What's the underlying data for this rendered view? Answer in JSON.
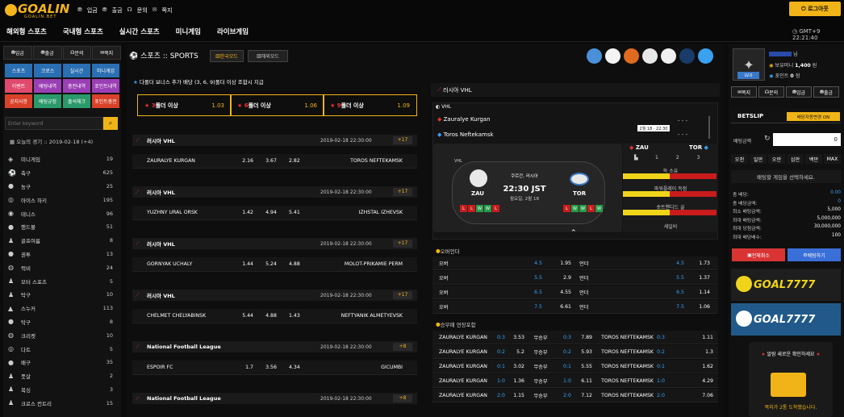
{
  "header": {
    "brand": "GOALIN",
    "brand_sub": "GOALIN.BET",
    "links": [
      "입금",
      "출금",
      "문의",
      "쪽지"
    ],
    "logout": "로그아웃",
    "nav": [
      "해외형 스포츠",
      "국내형 스포츠",
      "실시간 스포츠",
      "미니게임",
      "라이브게임"
    ],
    "clock": "GMT+9 22:21:40"
  },
  "sidebar": {
    "quick": [
      "입금",
      "출금",
      "문의",
      "쪽지"
    ],
    "categories": [
      {
        "label": "스포츠",
        "color": "#2b6fb3"
      },
      {
        "label": "크로스",
        "color": "#2b6fb3"
      },
      {
        "label": "실시간",
        "color": "#2b6fb3"
      },
      {
        "label": "미니게임",
        "color": "#2b6fb3"
      },
      {
        "label": "이벤트",
        "color": "#e04a6d"
      },
      {
        "label": "배팅내역",
        "color": "#9b3fb5"
      },
      {
        "label": "충전내역",
        "color": "#9b3fb5"
      },
      {
        "label": "포인트내역",
        "color": "#9b3fb5"
      },
      {
        "label": "공지사항",
        "color": "#d8412a"
      },
      {
        "label": "배팅규정",
        "color": "#2a9a6a"
      },
      {
        "label": "출석체크",
        "color": "#2a9a6a"
      },
      {
        "label": "포인트충전",
        "color": "#d8412a"
      }
    ],
    "keyword_placeholder": "Enter keyword",
    "today": "오늘의 경기 :: 2019-02-18 (+4)",
    "sports": [
      {
        "name": "미니게임",
        "count": "19",
        "icon": "◈"
      },
      {
        "name": "축구",
        "count": "625",
        "icon": "⚽"
      },
      {
        "name": "농구",
        "count": "25",
        "icon": "●"
      },
      {
        "name": "아이스 하키",
        "count": "195",
        "icon": "◎"
      },
      {
        "name": "테니스",
        "count": "96",
        "icon": "◉"
      },
      {
        "name": "핸드볼",
        "count": "51",
        "icon": "●"
      },
      {
        "name": "골프여름",
        "count": "8",
        "icon": "♟"
      },
      {
        "name": "권투",
        "count": "13",
        "icon": "●"
      },
      {
        "name": "럭비",
        "count": "24",
        "icon": "◍"
      },
      {
        "name": "모터 스포츠",
        "count": "5",
        "icon": "♟"
      },
      {
        "name": "탁구",
        "count": "10",
        "icon": "♟"
      },
      {
        "name": "스누커",
        "count": "113",
        "icon": "▲"
      },
      {
        "name": "탁구",
        "count": "8",
        "icon": "●"
      },
      {
        "name": "크리켓",
        "count": "10",
        "icon": "◍"
      },
      {
        "name": "다트",
        "count": "5",
        "icon": "◎"
      },
      {
        "name": "배구",
        "count": "35",
        "icon": "●"
      },
      {
        "name": "풋살",
        "count": "2",
        "icon": "♟"
      },
      {
        "name": "복싱",
        "count": "3",
        "icon": "♟"
      },
      {
        "name": "크로스 컨트리",
        "count": "15",
        "icon": "♟"
      }
    ]
  },
  "center": {
    "title": "스포츠 :: SPORTS",
    "tab_active": "한국모드",
    "tab_other": "해외모드",
    "ball_colors": [
      "#4a8fd8",
      "#f4f4f4",
      "#e06a20",
      "#e8e8e8",
      "#f0f0f0",
      "#1a3a6a",
      "#3aa0f0"
    ],
    "bonus_header": "다폴더 보너스 추가 배당 (3, 6, 9)폴더 이상 조합시 지급",
    "bonus": [
      {
        "num": "3",
        "label": "폴더 이상",
        "value": "1.03"
      },
      {
        "num": "6",
        "label": "폴더 이상",
        "value": "1.06"
      },
      {
        "num": "9",
        "label": "폴더 이상",
        "value": "1.09"
      }
    ],
    "matches": [
      {
        "league": "러시아 VHL",
        "date": "2019-02-18 22:30:00",
        "plus": "+17",
        "home": "ZAURALYE KURGAN",
        "o1": "2.16",
        "od": "3.67",
        "o2": "2.82",
        "away": "TOROS NEFTEKAMSK"
      },
      {
        "league": "러시아 VHL",
        "date": "2019-02-18 22:30:00",
        "plus": "+17",
        "home": "YUZHNY URAL ORSK",
        "o1": "1.42",
        "od": "4.94",
        "o2": "5.41",
        "away": "IZHSTAL IZHEVSK"
      },
      {
        "league": "러시아 VHL",
        "date": "2019-02-18 22:30:00",
        "plus": "+17",
        "home": "GORNYAK UCHALY",
        "o1": "1.44",
        "od": "5.24",
        "o2": "4.88",
        "away": "MOLOT-PRIKAMIE PERM"
      },
      {
        "league": "러시아 VHL",
        "date": "2019-02-18 22:30:00",
        "plus": "+17",
        "home": "CHELMET CHELYABINSK",
        "o1": "5.44",
        "od": "4.88",
        "o2": "1.43",
        "away": "NEFTYANIK ALMETYEVSK"
      },
      {
        "league": "National Football League",
        "date": "2019-02-18 22:30:00",
        "plus": "+8",
        "home": "ESPOIR FC",
        "o1": "1.7",
        "od": "3.56",
        "o2": "4.34",
        "away": "GICUMBI"
      },
      {
        "league": "National Football League",
        "date": "2019-02-18 22:30:00",
        "plus": "+8",
        "home": "",
        "o1": "",
        "od": "",
        "o2": "",
        "away": ""
      }
    ]
  },
  "event": {
    "league_bar": "러시아 VHL",
    "league": "VHL",
    "home": "Zauralye Kurgan",
    "away": "Toros Neftekamsk",
    "date_tag": "2월 18 · 22:30",
    "arena_league": "VHL",
    "arena_sub": "쿠르간, 러시아",
    "time": "22:30 JST",
    "day": "월요일, 2월 18",
    "home_abbr": "ZAU",
    "away_abbr": "TOR",
    "home_form": [
      "L",
      "L",
      "W",
      "W",
      "L"
    ],
    "away_form": [
      "L",
      "W",
      "W",
      "L",
      "W"
    ],
    "periods": [
      "1",
      "2",
      "3"
    ],
    "stats": [
      "득 소유",
      "파워플레이 득점",
      "숏트핸디드 골"
    ],
    "stat_last": "세일비"
  },
  "handicap": {
    "title": "오버언더",
    "rows": [
      {
        "a": "오버",
        "b": "4.5",
        "c": "1.95",
        "d": "언더",
        "e": "4.5",
        "f": "1.73"
      },
      {
        "a": "오버",
        "b": "5.5",
        "c": "2.9",
        "d": "언더",
        "e": "5.5",
        "f": "1.37"
      },
      {
        "a": "오버",
        "b": "6.5",
        "c": "4.55",
        "d": "언더",
        "e": "6.5",
        "f": "1.14"
      },
      {
        "a": "오버",
        "b": "7.5",
        "c": "6.61",
        "d": "언더",
        "e": "7.5",
        "f": "1.06"
      }
    ]
  },
  "winner": {
    "title": "승무패 연장포함",
    "rows": [
      {
        "h": "ZAURALYE KURGAN",
        "hn": "0:3",
        "ho": "3.53",
        "m": "무승부",
        "mn": "0:3",
        "mo": "7.89",
        "a": "TOROS NEFTEKAMSK",
        "an": "0:3",
        "ao": "1.11"
      },
      {
        "h": "ZAURALYE KURGAN",
        "hn": "0:2",
        "ho": "5.2",
        "m": "무승부",
        "mn": "0:2",
        "mo": "5.93",
        "a": "TOROS NEFTEKAMSK",
        "an": "0:2",
        "ao": "1.3"
      },
      {
        "h": "ZAURALYE KURGAN",
        "hn": "0:1",
        "ho": "3.02",
        "m": "무승부",
        "mn": "0:1",
        "mo": "5.55",
        "a": "TOROS NEFTEKAMSK",
        "an": "0:1",
        "ao": "1.62"
      },
      {
        "h": "ZAURALYE KURGAN",
        "hn": "1:0",
        "ho": "1.36",
        "m": "무승부",
        "mn": "1:0",
        "mo": "6.11",
        "a": "TOROS NEFTEKAMSK",
        "an": "1:0",
        "ao": "4.29"
      },
      {
        "h": "ZAURALYE KURGAN",
        "hn": "2:0",
        "ho": "1.15",
        "m": "무승부",
        "mn": "2:0",
        "mo": "7.12",
        "a": "TOROS NEFTEKAMSK",
        "an": "2:0",
        "ao": "7.06"
      }
    ]
  },
  "user": {
    "name_suffix": "님",
    "level": "LV.0",
    "money_label": "보유머니",
    "money": "1,400",
    "money_unit": "원",
    "point_label": "포인트",
    "point": "0",
    "point_unit": "점",
    "buttons": [
      "쪽지",
      "문의",
      "입금",
      "출금"
    ]
  },
  "betslip": {
    "title": "BETSLIP",
    "change_btn": "배당자동변경 ON",
    "amount_label": "배팅금액",
    "amount": "0",
    "chips": [
      "오천",
      "일만",
      "오만",
      "십만",
      "백만",
      "MAX"
    ],
    "hint": "배팅할 게임을 선택하세요.",
    "stats": [
      {
        "label": "총 배당:",
        "value": "0.00",
        "blue": true
      },
      {
        "label": "총 배당금액:",
        "value": "0",
        "blue": true
      },
      {
        "label": "최소 배팅금액:",
        "value": "5,000",
        "blue": false
      },
      {
        "label": "최대 배팅금액:",
        "value": "5,000,000",
        "blue": false
      },
      {
        "label": "최대 당첨금액:",
        "value": "30,000,000",
        "blue": false
      },
      {
        "label": "최대 배당배수:",
        "value": "100",
        "blue": false
      }
    ],
    "cancel": "전체취소",
    "bet": "배팅하기"
  },
  "banners": {
    "kakao": "GOAL7777",
    "telegram": "GOAL7777"
  },
  "notice": {
    "title": "알람 새로운 확인하세요",
    "sub": "쪽지가 2통 도착했습니다."
  }
}
